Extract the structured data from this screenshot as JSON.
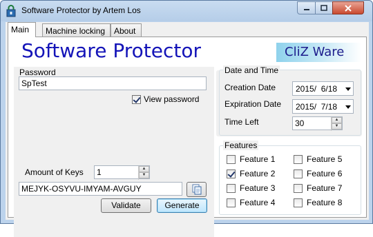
{
  "window": {
    "title": "Software Protector by Artem Los"
  },
  "tabs": [
    {
      "label": "Main",
      "active": true
    },
    {
      "label": "Machine locking",
      "active": false
    },
    {
      "label": "About",
      "active": false
    }
  ],
  "banner": {
    "title": "Software Protector",
    "brand": "CliZ Ware"
  },
  "password": {
    "label": "Password",
    "value": "SpTest",
    "view_label": "View password",
    "view_checked": true
  },
  "keys": {
    "amount_label": "Amount of Keys",
    "amount_value": "1",
    "generated_key": "MEJYK-OSYVU-IMYAM-AVGUY"
  },
  "buttons": {
    "validate": "Validate",
    "generate": "Generate"
  },
  "datetime": {
    "group_title": "Date and Time",
    "creation_label": "Creation Date",
    "creation_value": "2015/  6/18",
    "expiration_label": "Expiration Date",
    "expiration_value": "2015/  7/18",
    "timeleft_label": "Time Left",
    "timeleft_value": "30"
  },
  "features": {
    "group_title": "Features",
    "items": [
      {
        "label": "Feature 1",
        "checked": false
      },
      {
        "label": "Feature 2",
        "checked": true
      },
      {
        "label": "Feature 3",
        "checked": false
      },
      {
        "label": "Feature 4",
        "checked": false
      },
      {
        "label": "Feature 5",
        "checked": false
      },
      {
        "label": "Feature 6",
        "checked": false
      },
      {
        "label": "Feature 7",
        "checked": false
      },
      {
        "label": "Feature 8",
        "checked": false
      }
    ]
  }
}
